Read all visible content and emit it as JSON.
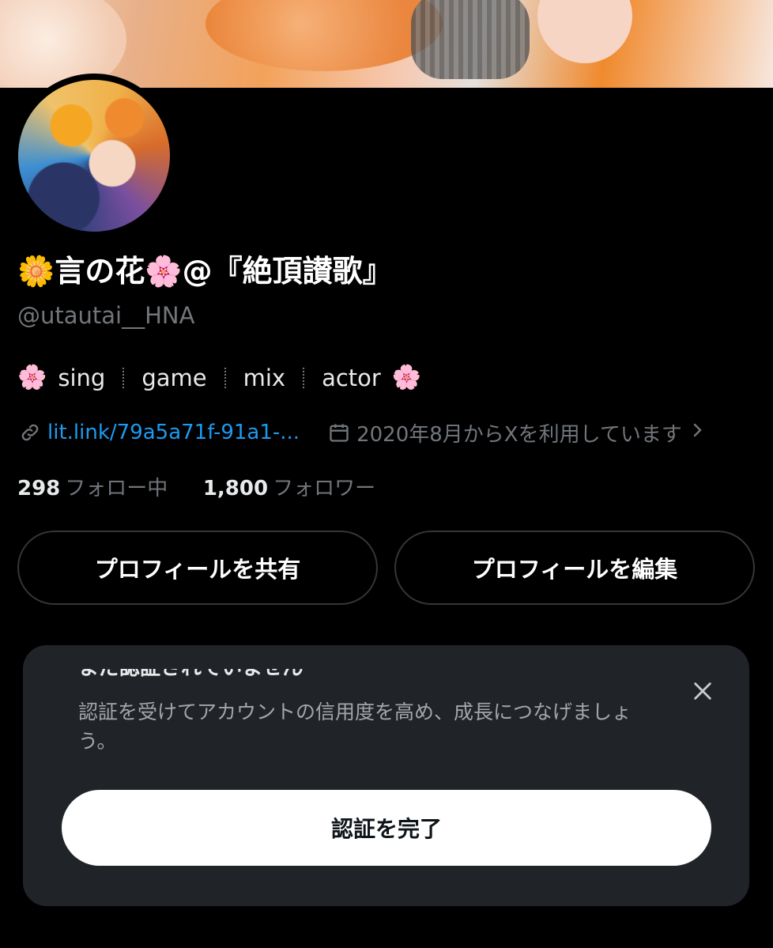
{
  "profile": {
    "display_name": "🌼言の花🌸@『絶頂讃歌』",
    "handle": "@utautai__HNA",
    "bio": {
      "lead_emoji": "🌸",
      "tags": [
        "sing",
        "game",
        "mix",
        "actor"
      ],
      "trail_emoji": "🌸"
    },
    "link": "lit.link/79a5a71f-91a1-...",
    "joined": "2020年8月からXを利用しています",
    "following_count": "298",
    "following_label": "フォロー中",
    "followers_count": "1,800",
    "followers_label": "フォロワー"
  },
  "actions": {
    "share_label": "プロフィールを共有",
    "edit_label": "プロフィールを編集"
  },
  "verification_card": {
    "cut_title": "まだ認証されていません",
    "description": "認証を受けてアカウントの信用度を高め、成長につなげましょう。",
    "cta_label": "認証を完了"
  },
  "icons": {
    "link": "link-icon",
    "calendar": "calendar-icon",
    "chevron": "chevron-right-icon",
    "close": "close-icon"
  },
  "colors": {
    "background": "#000000",
    "link": "#1d9bf0",
    "muted": "#71767b",
    "card": "#202327"
  }
}
